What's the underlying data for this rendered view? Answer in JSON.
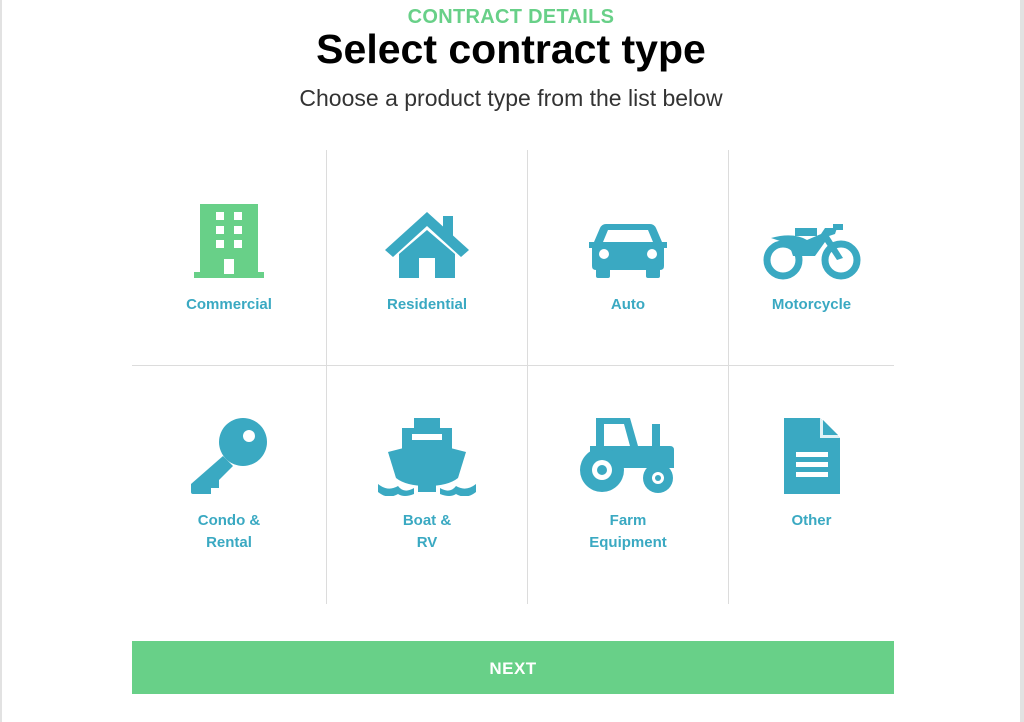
{
  "header": {
    "eyebrow": "CONTRACT DETAILS",
    "title": "Select contract type",
    "subtitle": "Choose a product type from the list below"
  },
  "colors": {
    "accent_green": "#68d088",
    "icon_blue": "#3aa9c2"
  },
  "contract_types": [
    {
      "icon": "building-icon",
      "label_lines": [
        "Commercial"
      ],
      "selected": true
    },
    {
      "icon": "house-icon",
      "label_lines": [
        "Residential"
      ],
      "selected": false
    },
    {
      "icon": "car-icon",
      "label_lines": [
        "Auto"
      ],
      "selected": false
    },
    {
      "icon": "motorcycle-icon",
      "label_lines": [
        "Motorcycle"
      ],
      "selected": false
    },
    {
      "icon": "key-icon",
      "label_lines": [
        "Condo &",
        "Rental"
      ],
      "selected": false
    },
    {
      "icon": "ship-icon",
      "label_lines": [
        "Boat &",
        "RV"
      ],
      "selected": false
    },
    {
      "icon": "tractor-icon",
      "label_lines": [
        "Farm",
        "Equipment"
      ],
      "selected": false
    },
    {
      "icon": "document-icon",
      "label_lines": [
        "Other"
      ],
      "selected": false
    }
  ],
  "actions": {
    "next_label": "NEXT"
  }
}
